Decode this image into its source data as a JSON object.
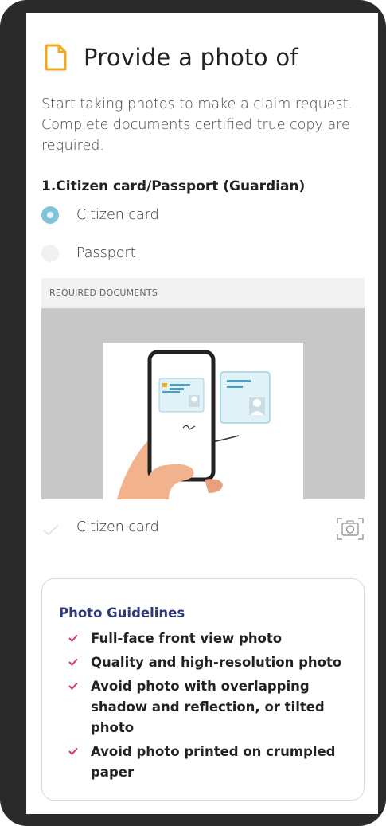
{
  "header": {
    "title": "Provide a photo of",
    "icon": "document-icon",
    "icon_color": "#f0a81f"
  },
  "intro_text": "Start taking photos to make a claim request. Complete documents certified true copy are required.",
  "section": {
    "title": "1.Citizen card/Passport (Guardian)",
    "options": [
      {
        "label": "Citizen card",
        "selected": true
      },
      {
        "label": "Passport",
        "selected": false
      }
    ]
  },
  "required_documents": {
    "label": "REQUIRED DOCUMENTS",
    "items": [
      {
        "label": "Citizen card",
        "icon": "camera-icon"
      }
    ]
  },
  "guidelines": {
    "title": "Photo Guidelines",
    "check_color": "#d6336c",
    "title_color": "#2f3a7a",
    "items": [
      "Full-face front view photo",
      "Quality and high-resolution photo",
      "Avoid photo with overlapping shadow and reflection, or tilted photo",
      "Avoid photo printed on crumpled paper"
    ]
  },
  "colors": {
    "accent": "#7fc4d8",
    "frame": "#2a2a2a"
  }
}
